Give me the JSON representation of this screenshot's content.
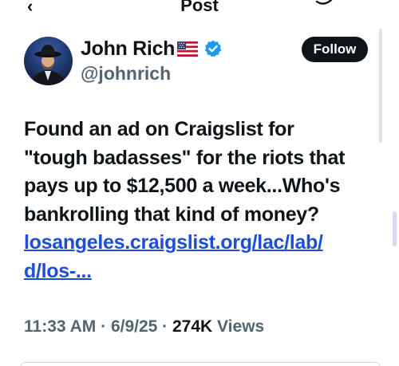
{
  "header": {
    "back_symbol": "‹",
    "title": "Post"
  },
  "post": {
    "author": {
      "name": "John Rich",
      "handle": "@johnrich",
      "flag": "us-flag-icon",
      "verified": true
    },
    "follow_label": "Follow",
    "text_lines": [
      "Found an ad on Craigslist for",
      "\"tough badasses\" for the riots that",
      "pays up to $12,500 a week...Who's",
      "bankrolling that kind of money?"
    ],
    "link_lines": [
      "losangeles.craigslist.org/lac/lab/",
      "d/los-..."
    ],
    "time": "11:33 AM",
    "date": "6/9/25",
    "views_count": "274K",
    "views_label": "Views",
    "separator": "·"
  },
  "colors": {
    "text": "#0f1419",
    "secondary": "#536471",
    "link": "#1d4ed8",
    "verified": "#1d9bf0",
    "follow_bg": "#0f1419"
  }
}
